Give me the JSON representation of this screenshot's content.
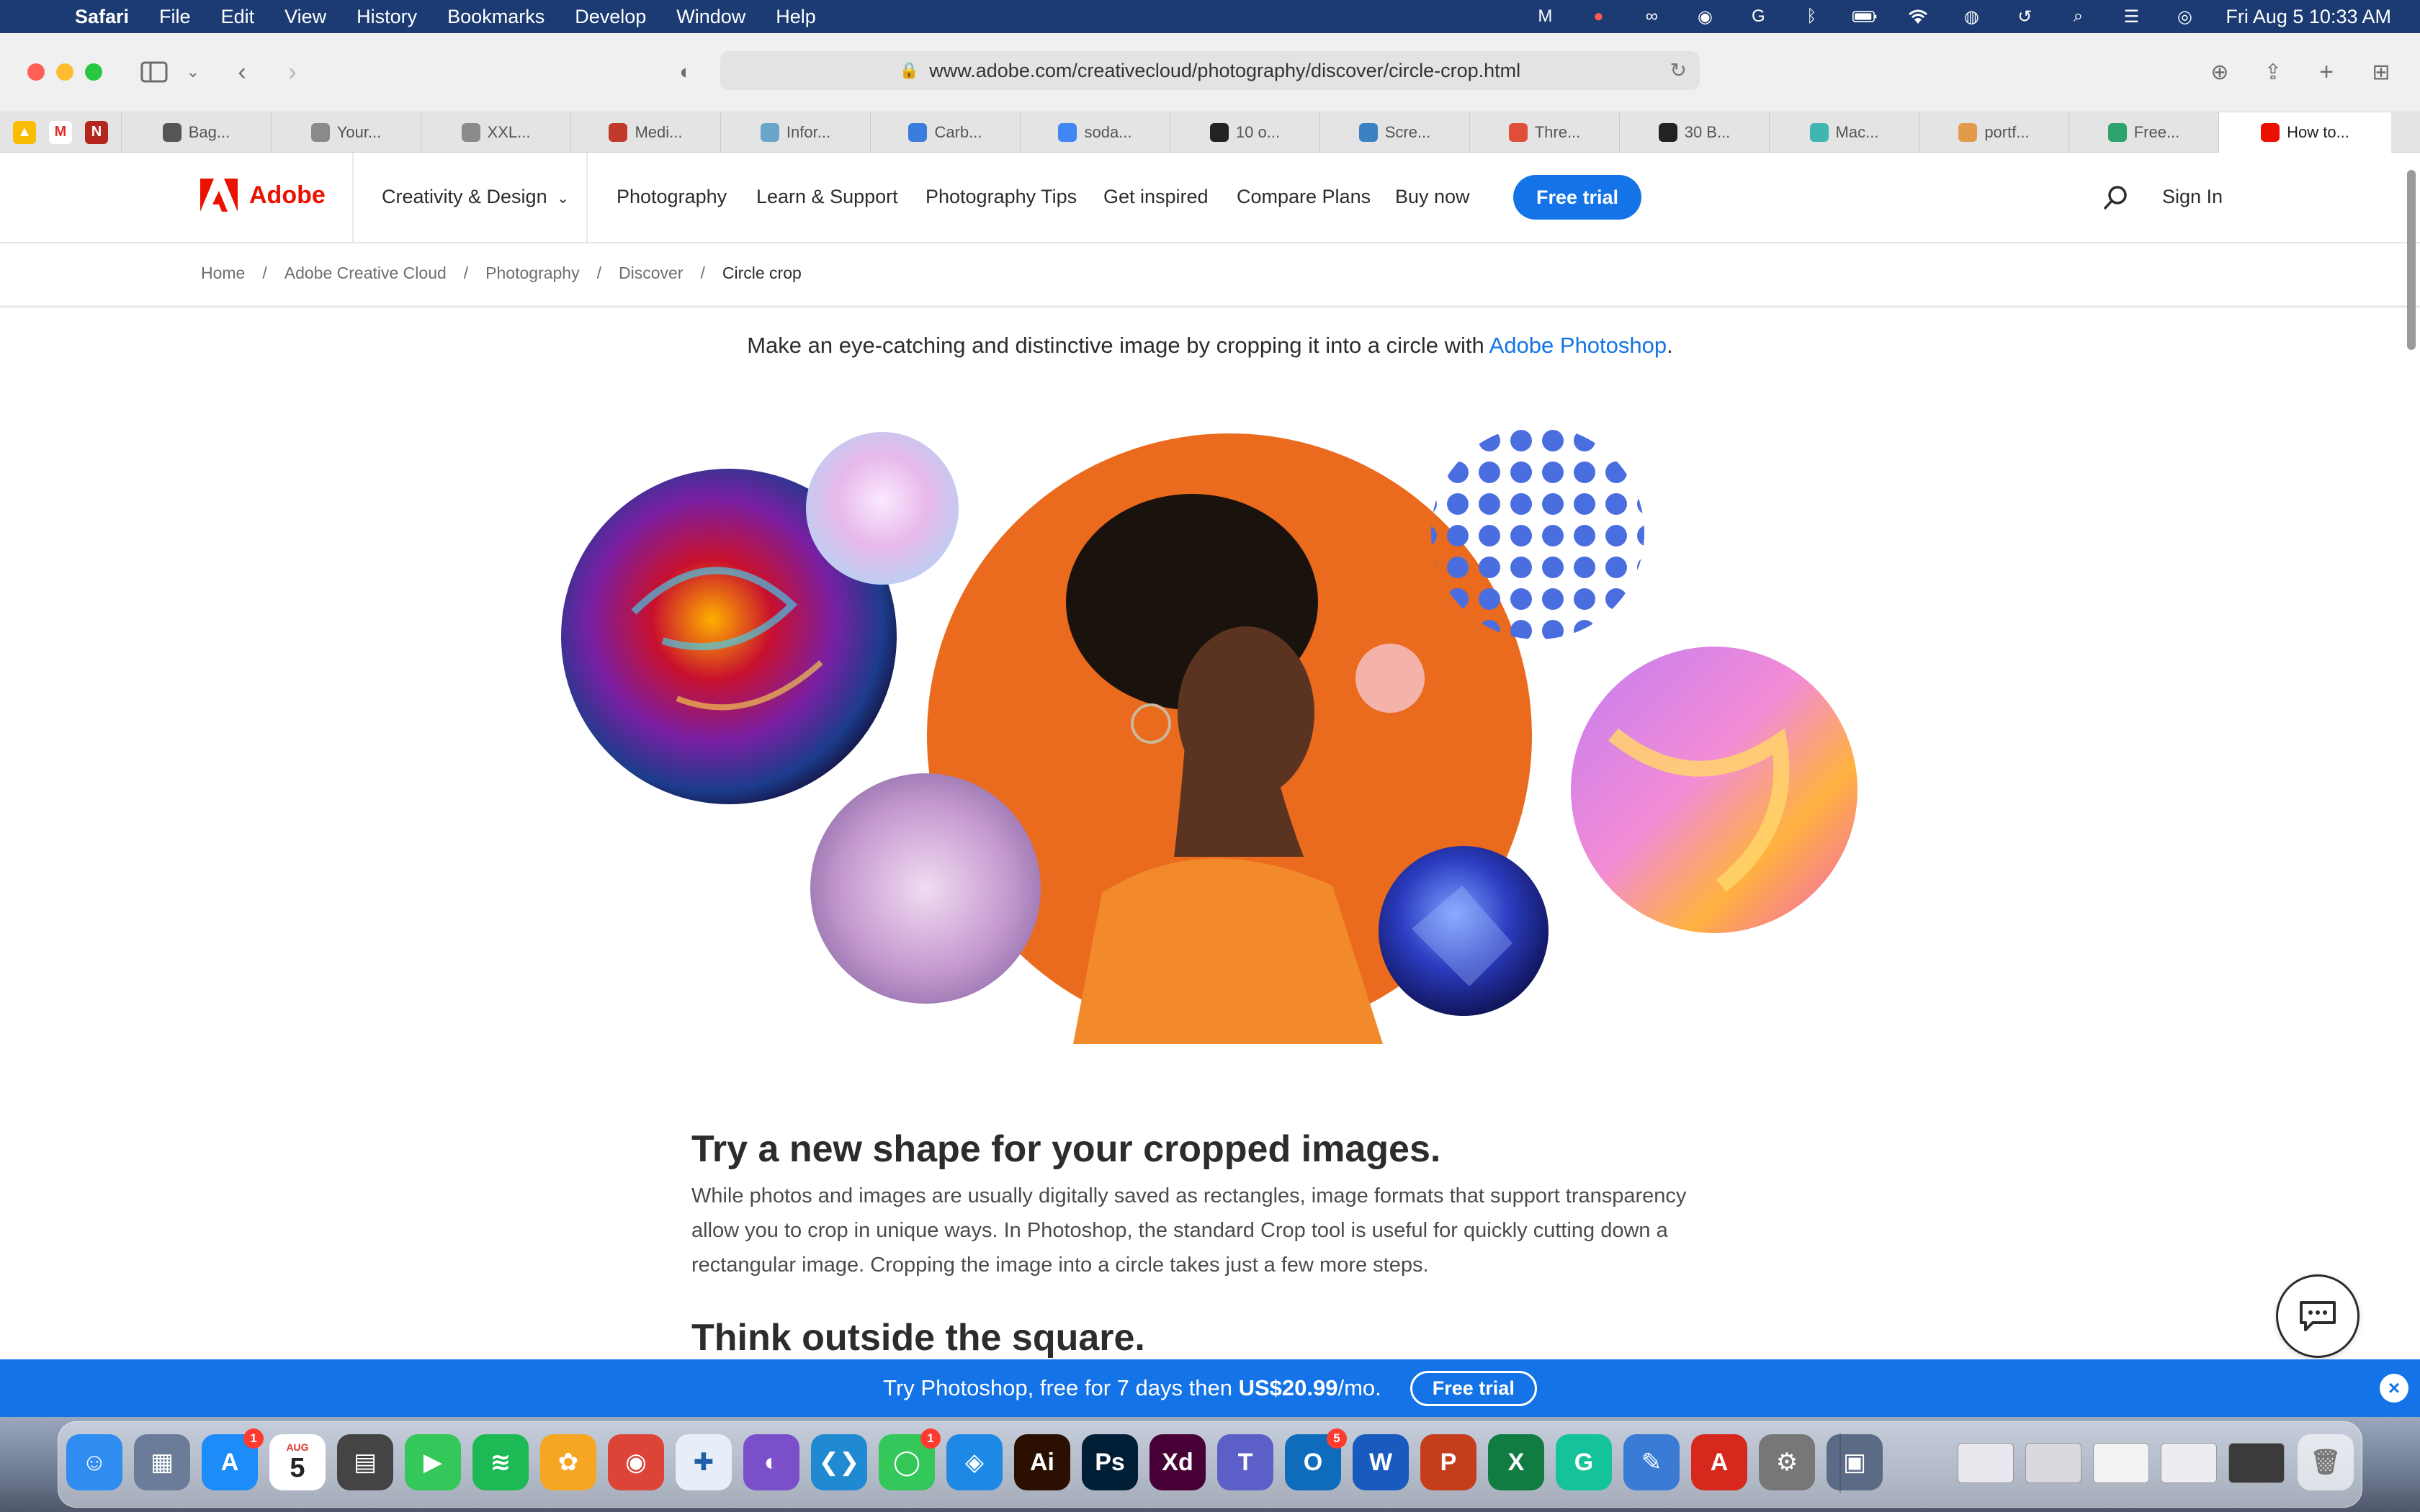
{
  "menubar": {
    "app_name": "Safari",
    "items": [
      "File",
      "Edit",
      "View",
      "History",
      "Bookmarks",
      "Develop",
      "Window",
      "Help"
    ],
    "clock": "Fri Aug 5  10:33 AM"
  },
  "browser": {
    "url": "www.adobe.com/creativecloud/photography/discover/circle-crop.html",
    "tabs": [
      {
        "label": "Bag...",
        "icon": "apple-icon",
        "color": "#555555"
      },
      {
        "label": "Your...",
        "icon": "f-icon",
        "color": "#8a8a8a"
      },
      {
        "label": "XXL...",
        "icon": "b-icon",
        "color": "#8a8a8a"
      },
      {
        "label": "Medi...",
        "icon": "bigjoe-icon",
        "color": "#c0392b"
      },
      {
        "label": "Infor...",
        "icon": "info-icon",
        "color": "#6aa6c9"
      },
      {
        "label": "Carb...",
        "icon": "carbon-icon",
        "color": "#3b7ddd"
      },
      {
        "label": "soda...",
        "icon": "google-icon",
        "color": "#4285f4"
      },
      {
        "label": "10 o...",
        "icon": "dark-circle-icon",
        "color": "#222222"
      },
      {
        "label": "Scre...",
        "icon": "s-icon",
        "color": "#3b82c4"
      },
      {
        "label": "Thre...",
        "icon": "flower-icon",
        "color": "#e04e39"
      },
      {
        "label": "30 B...",
        "icon": "video-icon",
        "color": "#222222"
      },
      {
        "label": "Mac...",
        "icon": "android-icon",
        "color": "#3fb6b2"
      },
      {
        "label": "portf...",
        "icon": "paper-plane-icon",
        "color": "#e29a4b"
      },
      {
        "label": "Free...",
        "icon": "p-icon",
        "color": "#2ea36b"
      },
      {
        "label": "How to...",
        "icon": "adobe-icon",
        "color": "#eb1000"
      }
    ]
  },
  "header": {
    "brand": "Adobe",
    "creativity": "Creativity & Design",
    "nav": [
      "Photography",
      "Learn & Support",
      "Photography Tips",
      "Get inspired",
      "Compare Plans",
      "Buy now"
    ],
    "free_trial": "Free trial",
    "sign_in": "Sign In"
  },
  "breadcrumb": [
    "Home",
    "Adobe Creative Cloud",
    "Photography",
    "Discover",
    "Circle crop"
  ],
  "content": {
    "intro_text": "Make an eye-catching and distinctive image by cropping it into a circle with ",
    "intro_link": "Adobe Photoshop",
    "intro_end": ".",
    "heading1": "Try a new shape for your cropped images.",
    "paragraph1": "While photos and images are usually digitally saved as rectangles, image formats that support transparency allow you to crop in unique ways. In Photoshop, the standard Crop tool is useful for quickly cutting down a rectangular image. Cropping the image into a circle takes just a few more steps.",
    "heading2": "Think outside the square."
  },
  "promo": {
    "text": "Try Photoshop, free for 7 days then ",
    "price": "US$20.99",
    "per": "/mo.",
    "button": "Free trial"
  },
  "dock": {
    "calendar_month": "AUG",
    "calendar_day": "5",
    "badges": {
      "appstore": "1",
      "messages": "1",
      "outlook": "5"
    },
    "icons": [
      {
        "name": "finder",
        "glyph": "☺",
        "color": "#2f8cf0"
      },
      {
        "name": "launchpad",
        "glyph": "▦",
        "color": "#6b7c99"
      },
      {
        "name": "app-store",
        "glyph": "A",
        "color": "#1d8cf8"
      },
      {
        "name": "calendar",
        "glyph": "",
        "color": "#ffffff"
      },
      {
        "name": "calculator",
        "glyph": "▤",
        "color": "#444444"
      },
      {
        "name": "facetime",
        "glyph": "▶",
        "color": "#34c759"
      },
      {
        "name": "spotify",
        "glyph": "≋",
        "color": "#1db954"
      },
      {
        "name": "photos",
        "glyph": "✿",
        "color": "#f5a623"
      },
      {
        "name": "chrome",
        "glyph": "◉",
        "color": "#db4437"
      },
      {
        "name": "tableau",
        "glyph": "✚",
        "color": "#e8eef7"
      },
      {
        "name": "github",
        "glyph": "◐",
        "color": "#7b4fc9"
      },
      {
        "name": "vscode",
        "glyph": "❮❯",
        "color": "#1f8ad2"
      },
      {
        "name": "messages",
        "glyph": "◯",
        "color": "#34c759"
      },
      {
        "name": "safari",
        "glyph": "◈",
        "color": "#1e88e5"
      },
      {
        "name": "illustrator",
        "glyph": "Ai",
        "color": "#2b0f00"
      },
      {
        "name": "photoshop",
        "glyph": "Ps",
        "color": "#001e36"
      },
      {
        "name": "xd",
        "glyph": "Xd",
        "color": "#470137"
      },
      {
        "name": "teams",
        "glyph": "T",
        "color": "#5b5fc7"
      },
      {
        "name": "outlook",
        "glyph": "O",
        "color": "#0f6cbd"
      },
      {
        "name": "word",
        "glyph": "W",
        "color": "#185abd"
      },
      {
        "name": "powerpoint",
        "glyph": "P",
        "color": "#c43e1c"
      },
      {
        "name": "excel",
        "glyph": "X",
        "color": "#107c41"
      },
      {
        "name": "grammarly",
        "glyph": "G",
        "color": "#15c39a"
      },
      {
        "name": "sketch-pencil",
        "glyph": "✎",
        "color": "#3a7bd5"
      },
      {
        "name": "acrobat",
        "glyph": "A",
        "color": "#d6281c"
      },
      {
        "name": "system-preferences",
        "glyph": "⚙",
        "color": "#777777"
      },
      {
        "name": "preview",
        "glyph": "▣",
        "color": "#5c6b85"
      }
    ],
    "recent": [
      {
        "name": "recent-xd-1",
        "color": "#e8e8ee"
      },
      {
        "name": "recent-xd-2",
        "color": "#d9d9df"
      },
      {
        "name": "recent-chrome",
        "color": "#f2f2f2"
      },
      {
        "name": "recent-xd-3",
        "color": "#ececf2"
      },
      {
        "name": "recent-ai",
        "color": "#3b3b3b"
      }
    ]
  },
  "colors": {
    "accent": "#1473e6",
    "adobe_red": "#eb1000",
    "menubar": "#1b3b72"
  }
}
